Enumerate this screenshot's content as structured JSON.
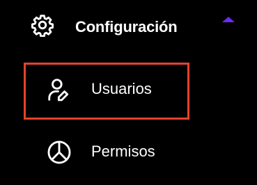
{
  "section": {
    "label": "Configuración",
    "icon": "gear-icon",
    "expanded_indicator_icon": "caret-up-icon",
    "caret_color": "#6a2cf0"
  },
  "items": [
    {
      "label": "Usuarios",
      "icon": "user-edit-icon",
      "highlighted": true
    },
    {
      "label": "Permisos",
      "icon": "pie-chart-icon",
      "highlighted": false
    }
  ],
  "colors": {
    "background": "#000000",
    "text": "#ffffff",
    "highlight_border": "#e5432d"
  }
}
